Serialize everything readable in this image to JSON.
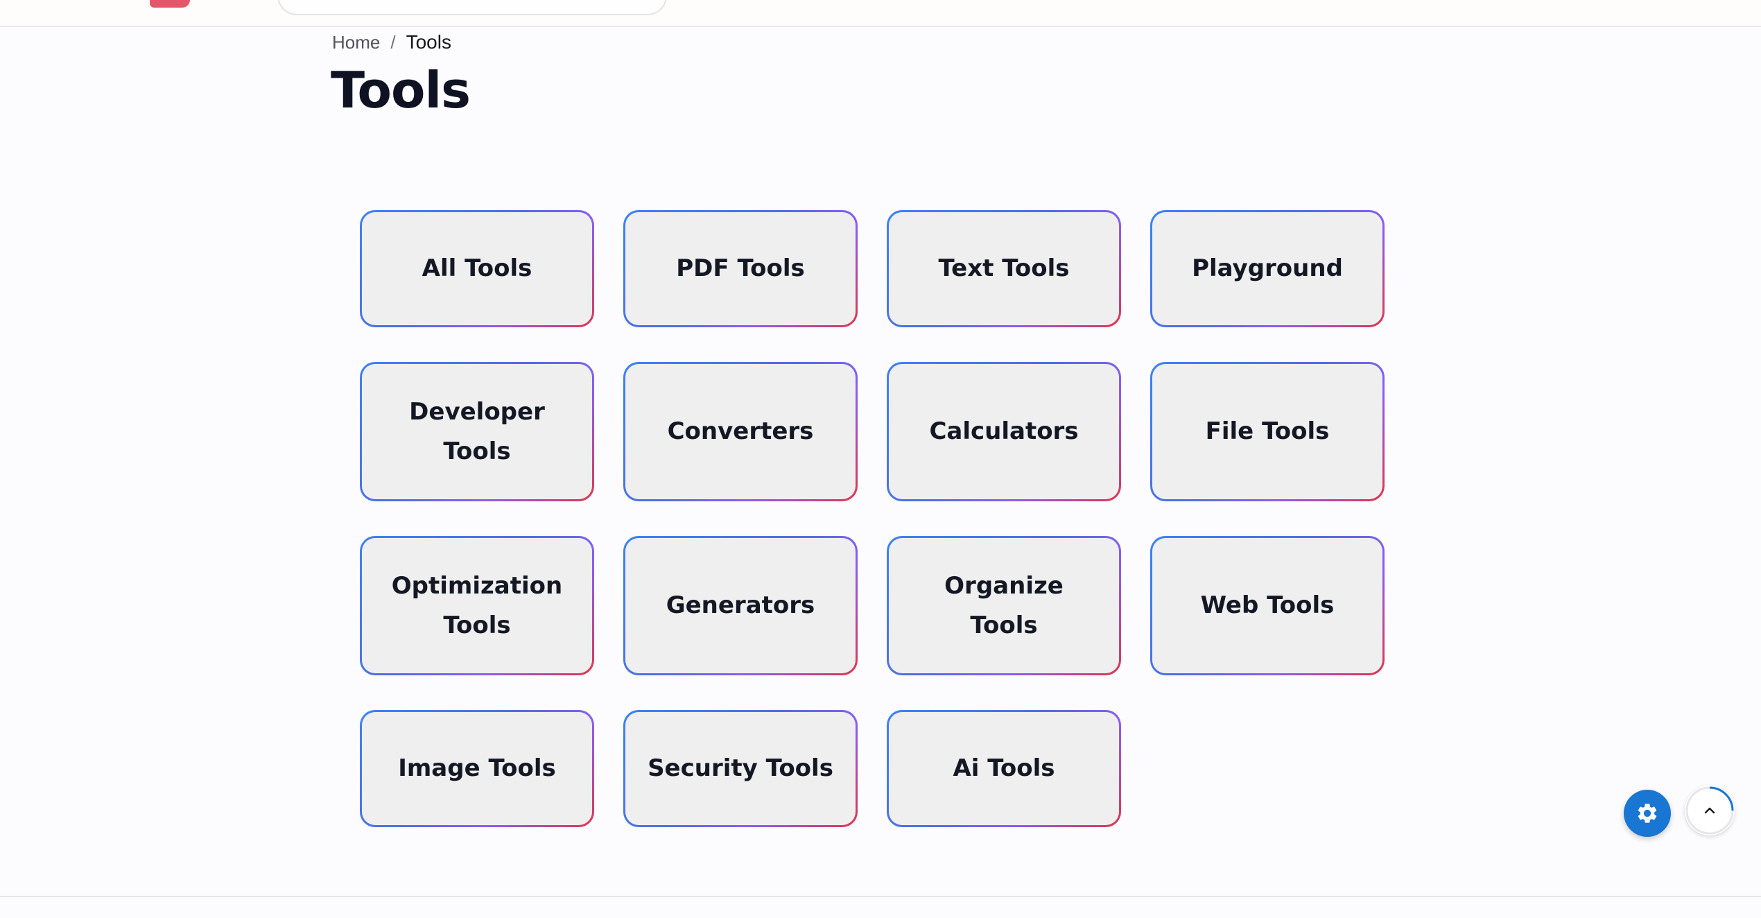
{
  "breadcrumb": {
    "home": "Home",
    "separator": "/",
    "current": "Tools"
  },
  "page": {
    "title": "Tools"
  },
  "categories": [
    {
      "label": "All Tools"
    },
    {
      "label": "PDF Tools"
    },
    {
      "label": "Text Tools"
    },
    {
      "label": "Playground"
    },
    {
      "label": "Developer Tools"
    },
    {
      "label": "Converters"
    },
    {
      "label": "Calculators"
    },
    {
      "label": "File Tools"
    },
    {
      "label": "Optimization Tools"
    },
    {
      "label": "Generators"
    },
    {
      "label": "Organize Tools"
    },
    {
      "label": "Web Tools"
    },
    {
      "label": "Image Tools"
    },
    {
      "label": "Security Tools"
    },
    {
      "label": "Ai Tools"
    }
  ],
  "floating_buttons": {
    "settings_icon": "gear-icon",
    "scroll_top_icon": "chevron-up-icon",
    "scroll_progress": 0.25
  },
  "colors": {
    "accent": "#1976d2",
    "card_border_start": "#3b82f6",
    "card_border_end": "#e0364a"
  }
}
